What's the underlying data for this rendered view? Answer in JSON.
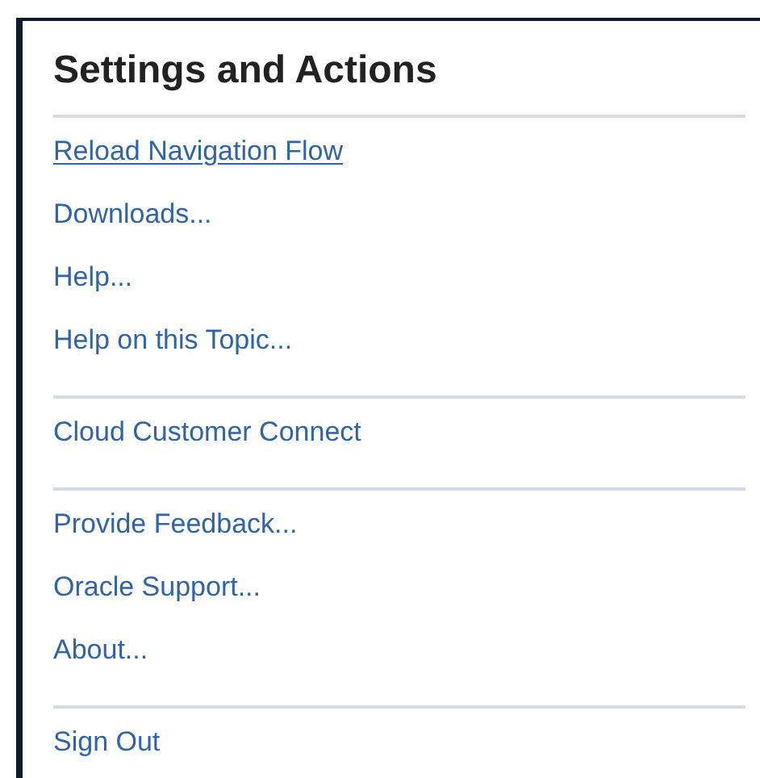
{
  "title": "Settings and Actions",
  "sections": [
    {
      "items": [
        {
          "label": "Reload Navigation Flow",
          "selected": true
        },
        {
          "label": "Downloads...",
          "selected": false
        },
        {
          "label": "Help...",
          "selected": false
        },
        {
          "label": "Help on this Topic...",
          "selected": false
        }
      ]
    },
    {
      "items": [
        {
          "label": "Cloud Customer Connect",
          "selected": false
        }
      ]
    },
    {
      "items": [
        {
          "label": "Provide Feedback...",
          "selected": false
        },
        {
          "label": "Oracle Support...",
          "selected": false
        },
        {
          "label": "About...",
          "selected": false
        }
      ]
    },
    {
      "items": [
        {
          "label": "Sign Out",
          "selected": false
        }
      ]
    }
  ]
}
